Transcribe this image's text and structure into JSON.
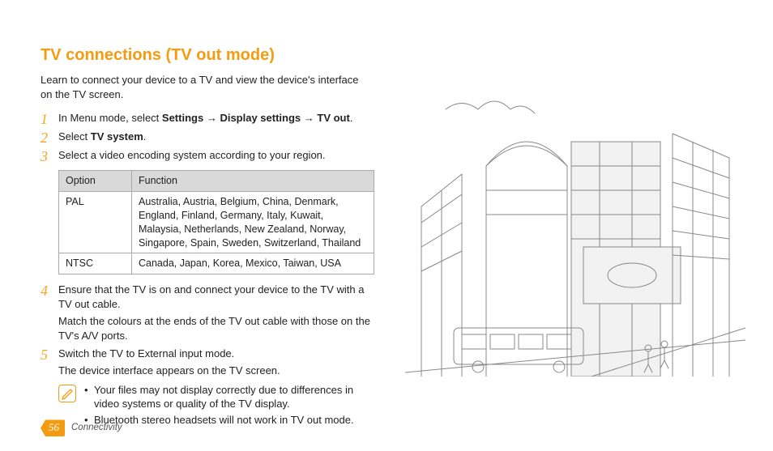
{
  "title": "TV connections (TV out mode)",
  "intro": "Learn to connect your device to a TV and view the device's interface on the TV screen.",
  "steps": {
    "s1": {
      "num": "1",
      "prefix": "In Menu mode, select ",
      "b1": "Settings",
      "arrow1": " → ",
      "b2": "Display settings",
      "arrow2": " → ",
      "b3": "TV out",
      "suffix": "."
    },
    "s2": {
      "num": "2",
      "prefix": "Select ",
      "b1": "TV system",
      "suffix": "."
    },
    "s3": {
      "num": "3",
      "text": "Select a video encoding system according to your region."
    },
    "s4": {
      "num": "4",
      "text": "Ensure that the TV is on and connect your device to the TV with a TV out cable.",
      "sub": "Match the colours at the ends of the TV out cable with those on the TV's A/V ports."
    },
    "s5": {
      "num": "5",
      "text": "Switch the TV to External input mode.",
      "sub": "The device interface appears on the TV screen."
    }
  },
  "table": {
    "h1": "Option",
    "h2": "Function",
    "r1c1": "PAL",
    "r1c2": "Australia, Austria, Belgium, China, Denmark, England, Finland, Germany, Italy, Kuwait, Malaysia, Netherlands, New Zealand, Norway, Singapore, Spain, Sweden, Switzerland, Thailand",
    "r2c1": "NTSC",
    "r2c2": "Canada, Japan, Korea, Mexico, Taiwan, USA"
  },
  "notes": {
    "n1": "Your files may not display correctly due to differences in video systems or quality of the TV display.",
    "n2": "Bluetooth stereo headsets will not work in TV out mode."
  },
  "footer": {
    "page": "56",
    "section": "Connectivity"
  }
}
